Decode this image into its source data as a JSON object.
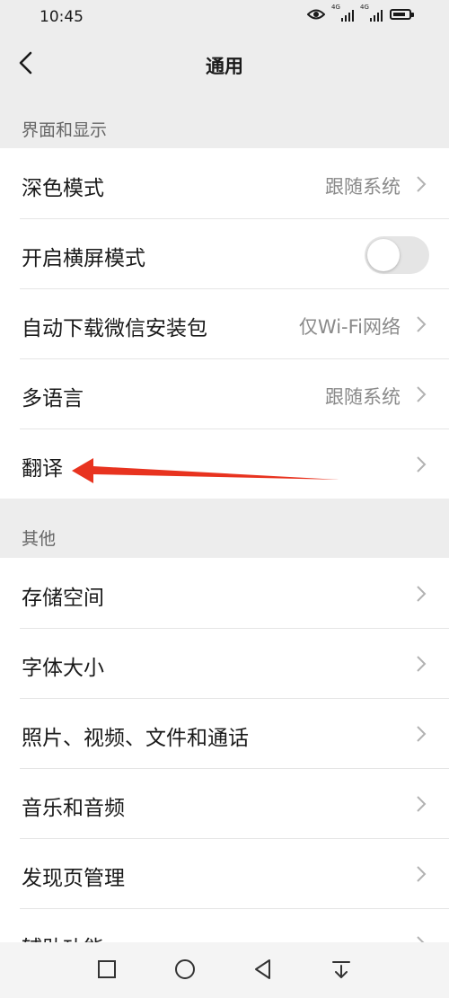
{
  "status_bar": {
    "time": "10:45",
    "signal_labels": [
      "4G",
      "4G"
    ],
    "battery_level": 0.8
  },
  "nav": {
    "title": "通用",
    "back_icon": "chevron-left-icon"
  },
  "sections": [
    {
      "header": "界面和显示",
      "items": [
        {
          "label": "深色模式",
          "value": "跟随系统",
          "chevron": true
        },
        {
          "label": "开启横屏模式",
          "toggle": false
        },
        {
          "label": "自动下载微信安装包",
          "value": "仅Wi-Fi网络",
          "chevron": true
        },
        {
          "label": "多语言",
          "value": "跟随系统",
          "chevron": true
        },
        {
          "label": "翻译",
          "value": "",
          "chevron": true
        }
      ]
    },
    {
      "header": "其他",
      "items": [
        {
          "label": "存储空间",
          "chevron": true
        },
        {
          "label": "字体大小",
          "chevron": true
        },
        {
          "label": "照片、视频、文件和通话",
          "chevron": true
        },
        {
          "label": "音乐和音频",
          "chevron": true
        },
        {
          "label": "发现页管理",
          "chevron": true
        },
        {
          "label": "辅助功能",
          "chevron": true
        }
      ]
    }
  ],
  "annotation": {
    "color": "#e8331f",
    "points_to": "翻译"
  },
  "system_nav": [
    "square-icon",
    "circle-icon",
    "triangle-back-icon",
    "dropdown-icon"
  ],
  "colors": {
    "background": "#ededed",
    "card": "#ffffff",
    "annotation_red": "#e8331f"
  }
}
